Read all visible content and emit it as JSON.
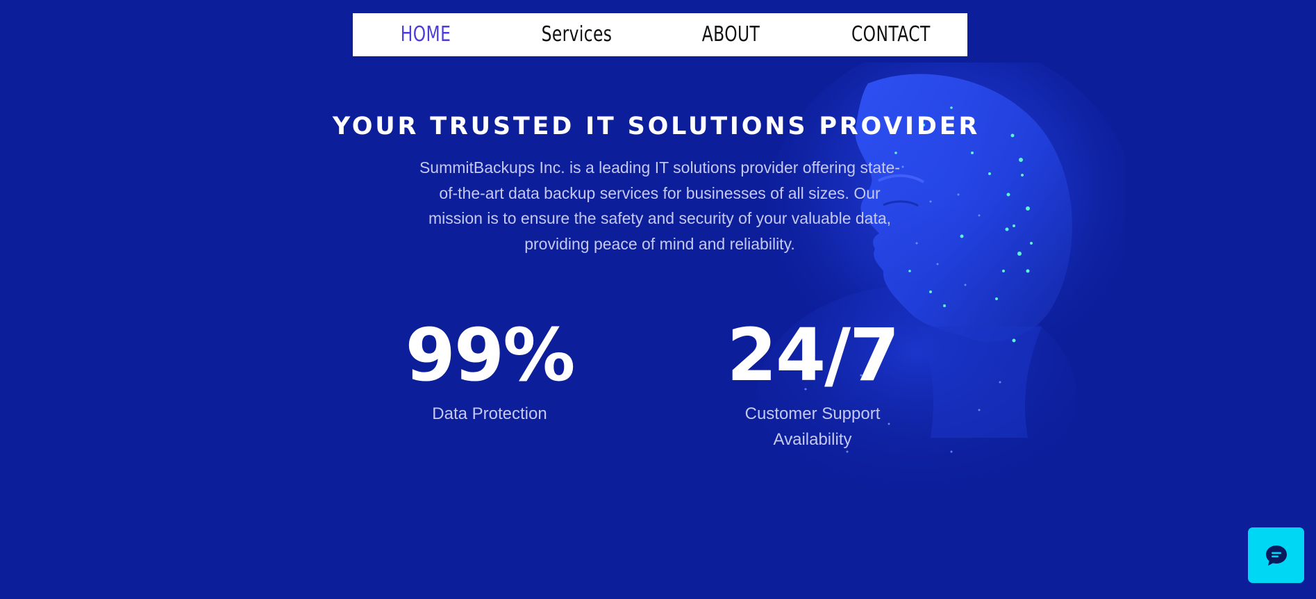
{
  "nav": {
    "items": [
      {
        "label": "HOME",
        "active": true
      },
      {
        "label": "Services",
        "active": false
      },
      {
        "label": "ABOUT",
        "active": false
      },
      {
        "label": "CONTACT",
        "active": false
      }
    ]
  },
  "hero": {
    "headline": "YOUR TRUSTED IT SOLUTIONS PROVIDER",
    "intro": "SummitBackups Inc. is a leading IT solutions provider offering state-of-the-art data backup services for businesses of all sizes. Our mission is to ensure the safety and security of your valuable data, providing peace of mind and reliability."
  },
  "stats": [
    {
      "value": "99%",
      "label": "Data Protection"
    },
    {
      "value": "24/7",
      "label": "Customer Support Availability"
    }
  ],
  "chat": {
    "icon": "chat-bubble-icon"
  },
  "colors": {
    "background": "#0c1e9a",
    "nav_background": "#ffffff",
    "nav_active": "#4b3cdb",
    "nav_text": "#111111",
    "body_text": "#c5c8ef",
    "chat_accent": "#00d7f4"
  }
}
